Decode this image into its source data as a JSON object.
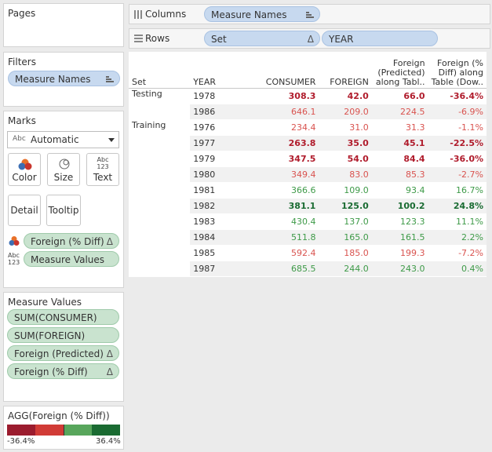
{
  "pages": {
    "title": "Pages"
  },
  "filters": {
    "title": "Filters",
    "items": [
      {
        "label": "Measure Names"
      }
    ]
  },
  "marks": {
    "title": "Marks",
    "mark_type": {
      "prefix": "Abc",
      "value": "Automatic"
    },
    "buttons": {
      "color": "Color",
      "size": "Size",
      "text": "Text",
      "detail": "Detail",
      "tooltip": "Tooltip",
      "text_icon_top": "Abc",
      "text_icon_bottom": "123"
    },
    "fields": [
      {
        "label": "Foreign (% Diff)",
        "glyph": "Δ"
      },
      {
        "label": "Measure Values",
        "prefix_top": "Abc",
        "prefix_bottom": "123"
      }
    ]
  },
  "measure_values": {
    "title": "Measure Values",
    "items": [
      {
        "label": "SUM(CONSUMER)",
        "glyph": ""
      },
      {
        "label": "SUM(FOREIGN)",
        "glyph": ""
      },
      {
        "label": "Foreign (Predicted)",
        "glyph": "Δ"
      },
      {
        "label": "Foreign (% Diff)",
        "glyph": "Δ"
      }
    ]
  },
  "legend": {
    "title": "AGG(Foreign (% Diff))",
    "min_label": "-36.4%",
    "max_label": "36.4%",
    "colors": [
      "#9b1c2e",
      "#d13b36",
      "#58a65c",
      "#1a6b32"
    ]
  },
  "columns_shelf": {
    "label": "Columns",
    "pills": [
      {
        "label": "Measure Names"
      }
    ]
  },
  "rows_shelf": {
    "label": "Rows",
    "pills": [
      {
        "label": "Set",
        "glyph": "Δ"
      },
      {
        "label": "YEAR"
      }
    ]
  },
  "colors": {
    "red": "#b01c2c",
    "red_light": "#d9534f",
    "green": "#3e9a48",
    "green_dark": "#1a6b32",
    "pill_blue": "#c7d9ef",
    "pill_green": "#c9e3cf"
  },
  "table": {
    "headers": {
      "set": "Set",
      "year": "YEAR",
      "consumer": "CONSUMER",
      "foreign": "FOREIGN",
      "predicted_1": "Foreign",
      "predicted_2": "(Predicted)",
      "predicted_3": "along Tabl..",
      "diff_1": "Foreign (%",
      "diff_2": "Diff) along",
      "diff_3": "Table (Dow.."
    },
    "groups": [
      {
        "set": "Testing",
        "rows": [
          {
            "year": "1978",
            "consumer": "308.3",
            "foreign": "42.0",
            "predicted": "66.0",
            "diff": "-36.4%",
            "tone": "red_dark"
          },
          {
            "year": "1986",
            "consumer": "646.1",
            "foreign": "209.0",
            "predicted": "224.5",
            "diff": "-6.9%",
            "tone": "red"
          }
        ]
      },
      {
        "set": "Training",
        "rows": [
          {
            "year": "1976",
            "consumer": "234.4",
            "foreign": "31.0",
            "predicted": "31.3",
            "diff": "-1.1%",
            "tone": "red"
          },
          {
            "year": "1977",
            "consumer": "263.8",
            "foreign": "35.0",
            "predicted": "45.1",
            "diff": "-22.5%",
            "tone": "red_dark"
          },
          {
            "year": "1979",
            "consumer": "347.5",
            "foreign": "54.0",
            "predicted": "84.4",
            "diff": "-36.0%",
            "tone": "red_dark"
          },
          {
            "year": "1980",
            "consumer": "349.4",
            "foreign": "83.0",
            "predicted": "85.3",
            "diff": "-2.7%",
            "tone": "red"
          },
          {
            "year": "1981",
            "consumer": "366.6",
            "foreign": "109.0",
            "predicted": "93.4",
            "diff": "16.7%",
            "tone": "green"
          },
          {
            "year": "1982",
            "consumer": "381.1",
            "foreign": "125.0",
            "predicted": "100.2",
            "diff": "24.8%",
            "tone": "green_dark"
          },
          {
            "year": "1983",
            "consumer": "430.4",
            "foreign": "137.0",
            "predicted": "123.3",
            "diff": "11.1%",
            "tone": "green"
          },
          {
            "year": "1984",
            "consumer": "511.8",
            "foreign": "165.0",
            "predicted": "161.5",
            "diff": "2.2%",
            "tone": "green"
          },
          {
            "year": "1985",
            "consumer": "592.4",
            "foreign": "185.0",
            "predicted": "199.3",
            "diff": "-7.2%",
            "tone": "red"
          },
          {
            "year": "1987",
            "consumer": "685.5",
            "foreign": "244.0",
            "predicted": "243.0",
            "diff": "0.4%",
            "tone": "green"
          }
        ]
      }
    ]
  }
}
